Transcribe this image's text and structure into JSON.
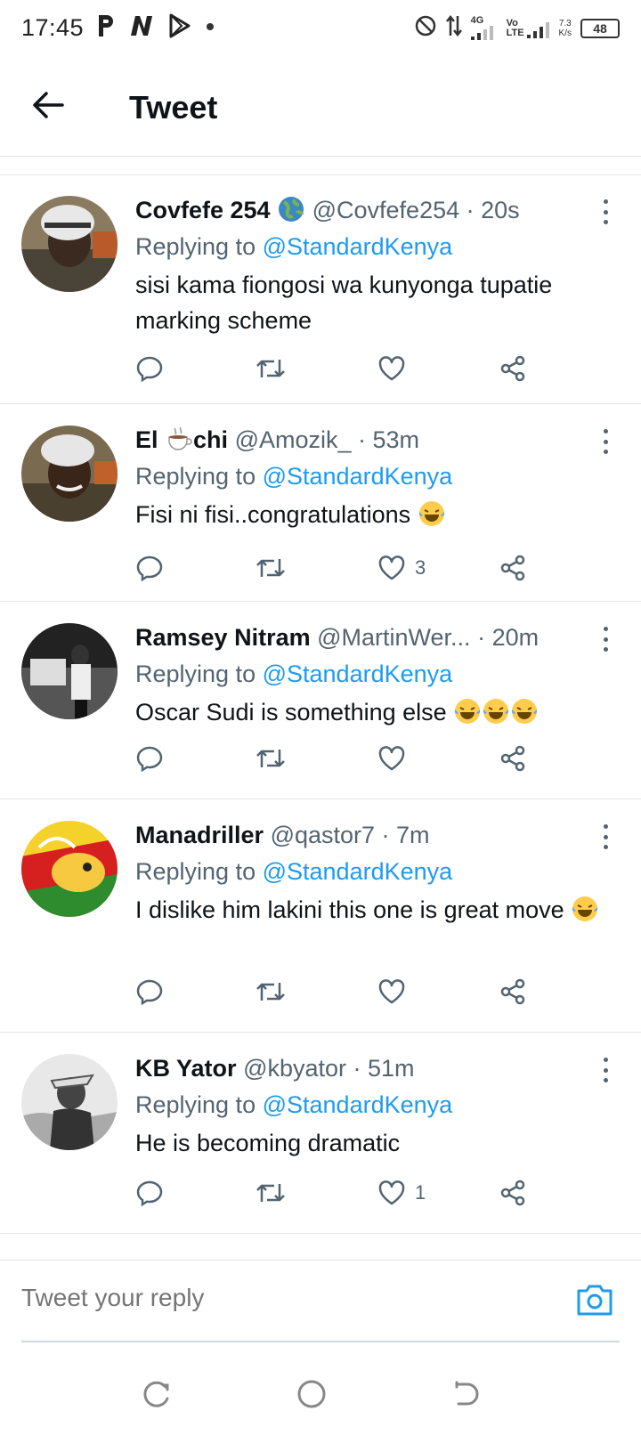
{
  "status_bar": {
    "time": "17:45",
    "left_icons": [
      "p-icon",
      "n-icon",
      "play-icon",
      "dot-icon"
    ],
    "network_label_top": "4G",
    "volte_label_top": "Vo",
    "volte_label_bottom": "LTE",
    "speed_value": "7.3",
    "speed_unit": "K/s",
    "battery": "48"
  },
  "header": {
    "title": "Tweet"
  },
  "colors": {
    "link": "#1d9bf0",
    "muted": "#536471",
    "text": "#0f1419"
  },
  "tweets": [
    {
      "name": "Covfefe 254",
      "name_emoji": "globe",
      "handle": "@Covfefe254",
      "time": "· 20s",
      "replying_prefix": "Replying to",
      "replying_to": "@StandardKenya",
      "text": "sisi kama fiongosi wa kunyonga tupatie marking scheme",
      "likes": ""
    },
    {
      "name_part1": "El",
      "name_emoji": "coffee",
      "name_part2": "chi",
      "handle": "@Amozik_",
      "time": "· 53m",
      "replying_prefix": "Replying to",
      "replying_to": "@StandardKenya",
      "text": "Fisi ni fisi..congratulations",
      "likes": "3"
    },
    {
      "name": "Ramsey Nitram",
      "handle": "@MartinWer...",
      "time": "· 20m",
      "replying_prefix": "Replying to",
      "replying_to": "@StandardKenya",
      "text": "Oscar Sudi is something else",
      "likes": ""
    },
    {
      "name": "Manadriller",
      "handle": "@qastor7",
      "time": "· 7m",
      "replying_prefix": "Replying to",
      "replying_to": "@StandardKenya",
      "text": "I dislike him lakini this one is great move",
      "likes": ""
    },
    {
      "name": "KB Yator",
      "handle": "@kbyator",
      "time": "· 51m",
      "replying_prefix": "Replying to",
      "replying_to": "@StandardKenya",
      "text": "He is becoming dramatic",
      "likes": "1"
    }
  ],
  "composer": {
    "placeholder": "Tweet your reply"
  },
  "navbar": {
    "buttons": [
      "recent-apps-icon",
      "home-icon",
      "back-icon"
    ]
  }
}
